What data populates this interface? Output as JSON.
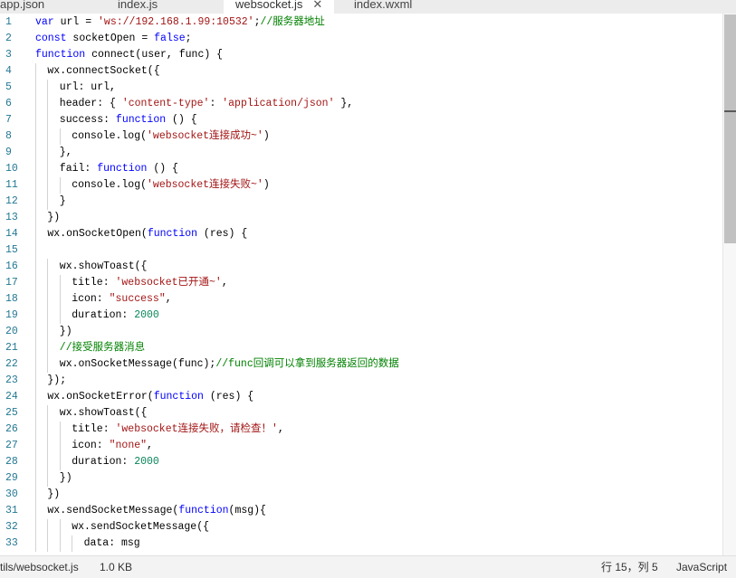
{
  "tabs": [
    {
      "label": "app.json",
      "active": false
    },
    {
      "label": "index.js",
      "active": false
    },
    {
      "label": "websocket.js",
      "active": true,
      "close_glyph": "✕"
    },
    {
      "label": "index.wxml",
      "active": false
    }
  ],
  "code_lines": [
    {
      "n": "1",
      "indent": 0,
      "tokens": [
        [
          "kw",
          "var"
        ],
        [
          "p",
          " url = "
        ],
        [
          "str",
          "'ws://192.168.1.99:10532'"
        ],
        [
          "p",
          ";"
        ],
        [
          "cmt",
          "//服务器地址"
        ]
      ]
    },
    {
      "n": "2",
      "indent": 0,
      "tokens": [
        [
          "kw",
          "const"
        ],
        [
          "p",
          " socketOpen = "
        ],
        [
          "kw",
          "false"
        ],
        [
          "p",
          ";"
        ]
      ]
    },
    {
      "n": "3",
      "indent": 0,
      "tokens": [
        [
          "kw",
          "function"
        ],
        [
          "p",
          " connect(user, func) {"
        ]
      ]
    },
    {
      "n": "4",
      "indent": 1,
      "tokens": [
        [
          "p",
          "wx.connectSocket({"
        ]
      ]
    },
    {
      "n": "5",
      "indent": 2,
      "tokens": [
        [
          "p",
          "url: url,"
        ]
      ]
    },
    {
      "n": "6",
      "indent": 2,
      "tokens": [
        [
          "p",
          "header: { "
        ],
        [
          "str",
          "'content-type'"
        ],
        [
          "p",
          ": "
        ],
        [
          "str",
          "'application/json'"
        ],
        [
          "p",
          " },"
        ]
      ]
    },
    {
      "n": "7",
      "indent": 2,
      "tokens": [
        [
          "p",
          "success: "
        ],
        [
          "kw",
          "function"
        ],
        [
          "p",
          " () {"
        ]
      ]
    },
    {
      "n": "8",
      "indent": 3,
      "tokens": [
        [
          "p",
          "console.log("
        ],
        [
          "str",
          "'websocket连接成功~'"
        ],
        [
          "p",
          ")"
        ]
      ]
    },
    {
      "n": "9",
      "indent": 2,
      "tokens": [
        [
          "p",
          "},"
        ]
      ]
    },
    {
      "n": "10",
      "indent": 2,
      "tokens": [
        [
          "p",
          "fail: "
        ],
        [
          "kw",
          "function"
        ],
        [
          "p",
          " () {"
        ]
      ]
    },
    {
      "n": "11",
      "indent": 3,
      "tokens": [
        [
          "p",
          "console.log("
        ],
        [
          "str",
          "'websocket连接失败~'"
        ],
        [
          "p",
          ")"
        ]
      ]
    },
    {
      "n": "12",
      "indent": 2,
      "tokens": [
        [
          "p",
          "}"
        ]
      ]
    },
    {
      "n": "13",
      "indent": 1,
      "tokens": [
        [
          "p",
          "})"
        ]
      ]
    },
    {
      "n": "14",
      "indent": 1,
      "tokens": [
        [
          "p",
          "wx.onSocketOpen("
        ],
        [
          "kw",
          "function"
        ],
        [
          "p",
          " (res) {"
        ]
      ]
    },
    {
      "n": "15",
      "indent": 0,
      "tokens": []
    },
    {
      "n": "16",
      "indent": 2,
      "tokens": [
        [
          "p",
          "wx.showToast({"
        ]
      ]
    },
    {
      "n": "17",
      "indent": 3,
      "tokens": [
        [
          "p",
          "title: "
        ],
        [
          "str",
          "'websocket已开通~'"
        ],
        [
          "p",
          ","
        ]
      ]
    },
    {
      "n": "18",
      "indent": 3,
      "tokens": [
        [
          "p",
          "icon: "
        ],
        [
          "str",
          "\"success\""
        ],
        [
          "p",
          ","
        ]
      ]
    },
    {
      "n": "19",
      "indent": 3,
      "tokens": [
        [
          "p",
          "duration: "
        ],
        [
          "num",
          "2000"
        ]
      ]
    },
    {
      "n": "20",
      "indent": 2,
      "tokens": [
        [
          "p",
          "})"
        ]
      ]
    },
    {
      "n": "21",
      "indent": 2,
      "tokens": [
        [
          "cmt",
          "//接受服务器消息"
        ]
      ]
    },
    {
      "n": "22",
      "indent": 2,
      "tokens": [
        [
          "p",
          "wx.onSocketMessage(func);"
        ],
        [
          "cmt",
          "//func回调可以拿到服务器返回的数据"
        ]
      ]
    },
    {
      "n": "23",
      "indent": 1,
      "tokens": [
        [
          "p",
          "});"
        ]
      ]
    },
    {
      "n": "24",
      "indent": 1,
      "tokens": [
        [
          "p",
          "wx.onSocketError("
        ],
        [
          "kw",
          "function"
        ],
        [
          "p",
          " (res) {"
        ]
      ]
    },
    {
      "n": "25",
      "indent": 2,
      "tokens": [
        [
          "p",
          "wx.showToast({"
        ]
      ]
    },
    {
      "n": "26",
      "indent": 3,
      "tokens": [
        [
          "p",
          "title: "
        ],
        [
          "str",
          "'websocket连接失败，请检查！'"
        ],
        [
          "p",
          ","
        ]
      ]
    },
    {
      "n": "27",
      "indent": 3,
      "tokens": [
        [
          "p",
          "icon: "
        ],
        [
          "str",
          "\"none\""
        ],
        [
          "p",
          ","
        ]
      ]
    },
    {
      "n": "28",
      "indent": 3,
      "tokens": [
        [
          "p",
          "duration: "
        ],
        [
          "num",
          "2000"
        ]
      ]
    },
    {
      "n": "29",
      "indent": 2,
      "tokens": [
        [
          "p",
          "})"
        ]
      ]
    },
    {
      "n": "30",
      "indent": 1,
      "tokens": [
        [
          "p",
          "})"
        ]
      ]
    },
    {
      "n": "31",
      "indent": 1,
      "tokens": [
        [
          "p",
          "wx.sendSocketMessage("
        ],
        [
          "kw",
          "function"
        ],
        [
          "p",
          "(msg){"
        ]
      ]
    },
    {
      "n": "32",
      "indent": 3,
      "tokens": [
        [
          "p",
          "wx.sendSocketMessage({"
        ]
      ]
    },
    {
      "n": "33",
      "indent": 4,
      "tokens": [
        [
          "p",
          "data: msg"
        ]
      ]
    }
  ],
  "status": {
    "file_path": "tils/websocket.js",
    "file_size": "1.0 KB",
    "cursor": "行 15，列 5",
    "language": "JavaScript"
  },
  "colors": {
    "keyword": "#0000ff",
    "string": "#a31515",
    "comment": "#008000",
    "number": "#098658",
    "line_number": "#237893"
  }
}
